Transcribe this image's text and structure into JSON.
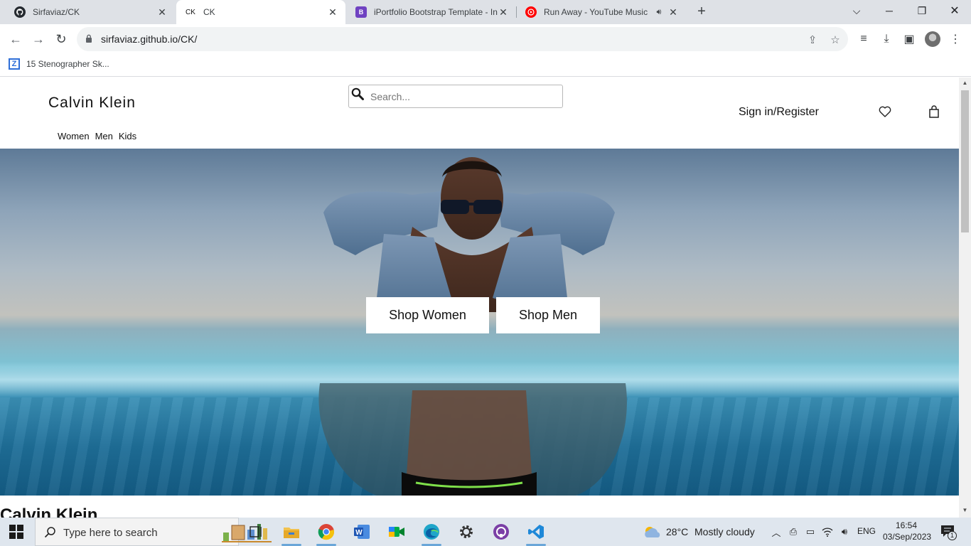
{
  "browser": {
    "tabs": [
      {
        "title": "Sirfaviaz/CK",
        "favicon": "github-icon",
        "active": false
      },
      {
        "title": "CK",
        "favicon": "ck-icon",
        "active": true
      },
      {
        "title": "iPortfolio Bootstrap Template - In",
        "favicon": "bootstrap-icon",
        "active": false
      },
      {
        "title": "Run Away - YouTube Music",
        "favicon": "youtube-music-icon",
        "active": false,
        "audio": true
      }
    ],
    "url": "sirfaviaz.github.io/CK/",
    "bookmarks": [
      {
        "label": "15 Stenographer Sk...",
        "icon": "z-icon"
      }
    ]
  },
  "page": {
    "logo": "Calvin Klein",
    "search": {
      "placeholder": "Search..."
    },
    "signin_label": "Sign in/Register",
    "nav": [
      "Women",
      "Men",
      "Kids"
    ],
    "hero_buttons": {
      "women": "Shop Women",
      "men": "Shop Men"
    },
    "section_heading": "Calvin Klein"
  },
  "taskbar": {
    "search_placeholder": "Type here to search",
    "weather": {
      "temp": "28°C",
      "condition": "Mostly cloudy"
    },
    "language": "ENG",
    "time": "16:54",
    "date": "03/Sep/2023",
    "notification_count": "1",
    "colors": {
      "accent": "#2f6fd8",
      "taskbar": "#dfe6ee"
    }
  }
}
